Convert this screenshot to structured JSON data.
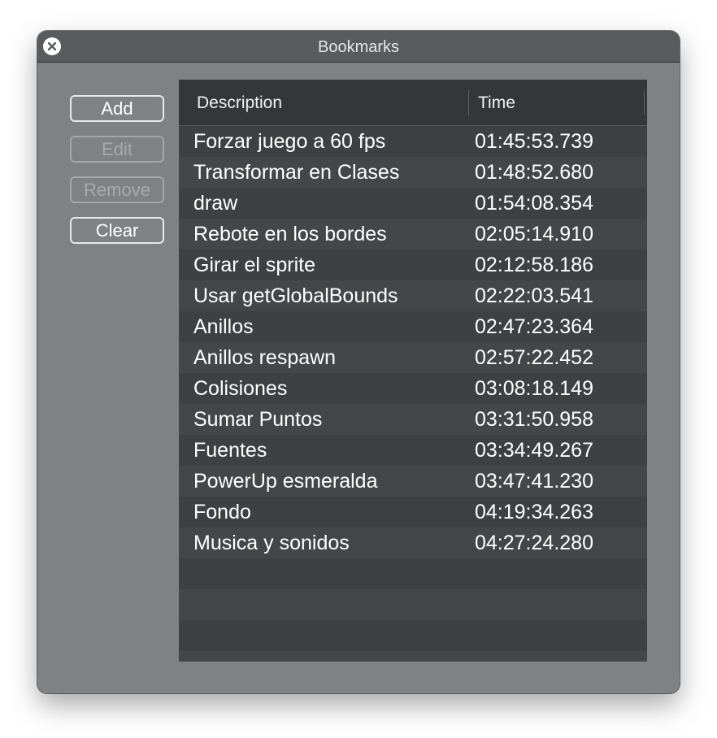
{
  "window": {
    "title": "Bookmarks",
    "close_icon": "close-x-icon"
  },
  "buttons": {
    "add": "Add",
    "edit": "Edit",
    "remove": "Remove",
    "clear": "Clear"
  },
  "table": {
    "columns": [
      "Description",
      "Time"
    ],
    "rows": [
      {
        "description": "Forzar juego a 60 fps",
        "time": "01:45:53.739"
      },
      {
        "description": "Transformar en Clases",
        "time": "01:48:52.680"
      },
      {
        "description": "draw",
        "time": "01:54:08.354"
      },
      {
        "description": "Rebote en los bordes",
        "time": "02:05:14.910"
      },
      {
        "description": "Girar el sprite",
        "time": "02:12:58.186"
      },
      {
        "description": "Usar getGlobalBounds",
        "time": "02:22:03.541"
      },
      {
        "description": "Anillos",
        "time": "02:47:23.364"
      },
      {
        "description": "Anillos respawn",
        "time": "02:57:22.452"
      },
      {
        "description": "Colisiones",
        "time": "03:08:18.149"
      },
      {
        "description": "Sumar Puntos",
        "time": "03:31:50.958"
      },
      {
        "description": "Fuentes",
        "time": "03:34:49.267"
      },
      {
        "description": "PowerUp esmeralda",
        "time": "03:47:41.230"
      },
      {
        "description": "Fondo",
        "time": "04:19:34.263"
      },
      {
        "description": "Musica y sonidos",
        "time": "04:27:24.280"
      }
    ]
  }
}
